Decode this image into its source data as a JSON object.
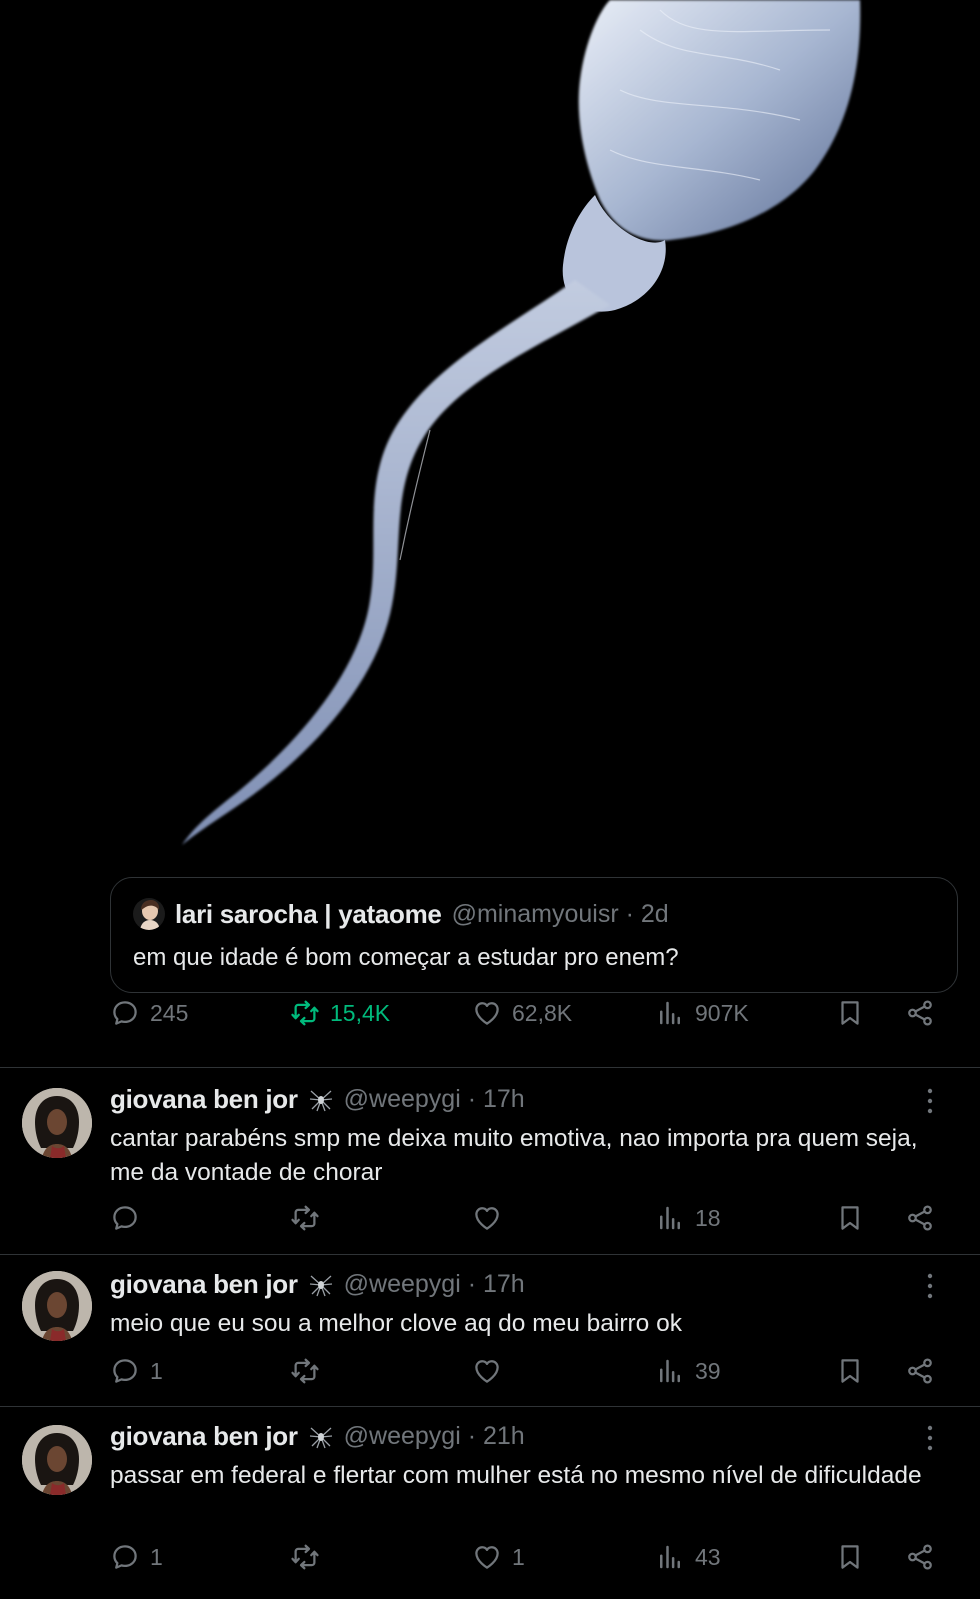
{
  "image": {
    "alt": "sperm-cell-illustration"
  },
  "quoted_post": {
    "name": "lari sarocha | yataome",
    "handle": "@minamyouisr",
    "time": "2d",
    "text": "em que idade é bom começar a estudar pro enem?"
  },
  "main_actions": {
    "replies": "245",
    "reposts": "15,4K",
    "likes": "62,8K",
    "views": "907K"
  },
  "replies": [
    {
      "name": "giovana ben jor",
      "handle": "@weepygi",
      "time": "17h",
      "text": "cantar parabéns smp me deixa muito emotiva, nao importa pra quem seja, me da vontade de chorar",
      "reply_count": "",
      "repost_count": "",
      "like_count": "",
      "views": "18"
    },
    {
      "name": "giovana ben jor",
      "handle": "@weepygi",
      "time": "17h",
      "text": "meio que eu sou a melhor clove aq do meu bairro ok",
      "reply_count": "1",
      "repost_count": "",
      "like_count": "",
      "views": "39"
    },
    {
      "name": "giovana ben jor",
      "handle": "@weepygi",
      "time": "21h",
      "text": "passar em federal e flertar com mulher está no mesmo nível de dificuldade",
      "reply_count": "1",
      "repost_count": "",
      "like_count": "1",
      "views": "43"
    }
  ],
  "colors": {
    "background": "#000000",
    "text": "#e7e9ea",
    "muted": "#71767b",
    "repost_active": "#00ba7c",
    "border": "#2f3336"
  },
  "icons": [
    "reply-icon",
    "repost-icon",
    "like-icon",
    "views-icon",
    "bookmark-icon",
    "share-icon",
    "more-icon",
    "spider-icon"
  ]
}
